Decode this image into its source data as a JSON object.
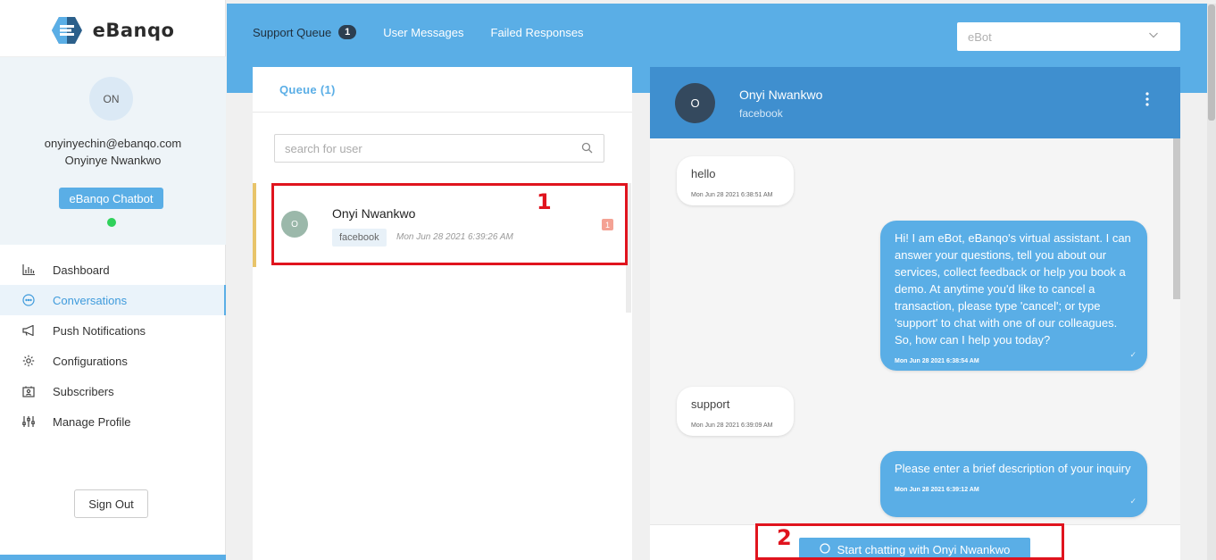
{
  "brand": {
    "name": "eBanqo",
    "accent": "#5aaee6"
  },
  "profile": {
    "initials": "ON",
    "email": "onyinyechin@ebanqo.com",
    "name": "Onyinye Nwankwo",
    "bot_badge": "eBanqo Chatbot",
    "status_color": "#2fd15b"
  },
  "nav": [
    {
      "label": "Dashboard",
      "icon": "bar-chart-icon"
    },
    {
      "label": "Conversations",
      "icon": "chat-bubble-icon",
      "active": true
    },
    {
      "label": "Push Notifications",
      "icon": "megaphone-icon"
    },
    {
      "label": "Configurations",
      "icon": "gear-icon"
    },
    {
      "label": "Subscribers",
      "icon": "contact-card-icon"
    },
    {
      "label": "Manage Profile",
      "icon": "sliders-icon"
    }
  ],
  "sign_out": "Sign Out",
  "tabs": [
    {
      "label": "Support Queue",
      "count": "1",
      "active": true
    },
    {
      "label": "User Messages"
    },
    {
      "label": "Failed Responses"
    }
  ],
  "bot_select": {
    "value": "eBot"
  },
  "queue": {
    "title": "Queue (1)",
    "search_placeholder": "search for user",
    "items": [
      {
        "initial": "O",
        "name": "Onyi Nwankwo",
        "channel": "facebook",
        "time": "Mon Jun 28 2021 6:39:26 AM",
        "unread": "1"
      }
    ]
  },
  "chat": {
    "avatar_initial": "O",
    "name": "Onyi Nwankwo",
    "channel": "facebook",
    "messages": [
      {
        "dir": "in",
        "text": "hello",
        "time": "Mon Jun 28 2021 6:38:51 AM"
      },
      {
        "dir": "out",
        "text": "Hi! I am eBot, eBanqo's virtual assistant. I can answer your questions, tell you about our services, collect feedback or help you book a demo. At anytime you'd like to cancel a transaction, please type 'cancel'; or type 'support' to chat with one of our colleagues. So, how can I help you today?",
        "time": "Mon Jun 28 2021 6:38:54 AM"
      },
      {
        "dir": "in",
        "text": "support",
        "time": "Mon Jun 28 2021 6:39:09 AM"
      },
      {
        "dir": "out",
        "text": "Please enter a brief description of your inquiry",
        "time": "Mon Jun 28 2021 6:39:12 AM"
      }
    ],
    "start_button": "Start chatting with Onyi Nwankwo"
  },
  "annotations": [
    "1",
    "2"
  ]
}
